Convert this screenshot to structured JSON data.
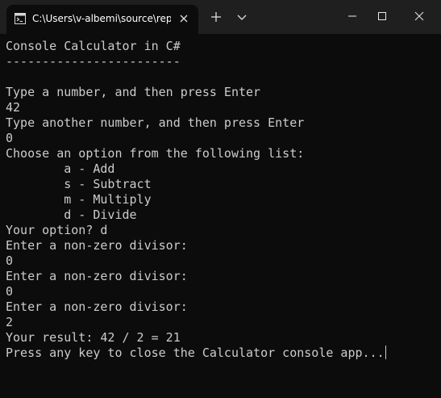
{
  "titlebar": {
    "tab_title": "C:\\Users\\v-albemi\\source\\rep",
    "icons": {
      "tab_icon": "terminal-icon",
      "tab_close": "close-icon",
      "new_tab": "plus-icon",
      "dropdown": "chevron-down-icon",
      "minimize": "minimize-icon",
      "maximize": "maximize-icon",
      "close": "close-icon"
    }
  },
  "console": {
    "lines": [
      "Console Calculator in C#",
      "------------------------",
      "",
      "Type a number, and then press Enter",
      "42",
      "Type another number, and then press Enter",
      "0",
      "Choose an option from the following list:",
      "        a - Add",
      "        s - Subtract",
      "        m - Multiply",
      "        d - Divide",
      "Your option? d",
      "Enter a non-zero divisor:",
      "0",
      "Enter a non-zero divisor:",
      "0",
      "Enter a non-zero divisor:",
      "2",
      "Your result: 42 / 2 = 21",
      "Press any key to close the Calculator console app..."
    ]
  },
  "colors": {
    "background": "#0c0c0c",
    "titlebar": "#1f1f1f",
    "text": "#cccccc"
  }
}
